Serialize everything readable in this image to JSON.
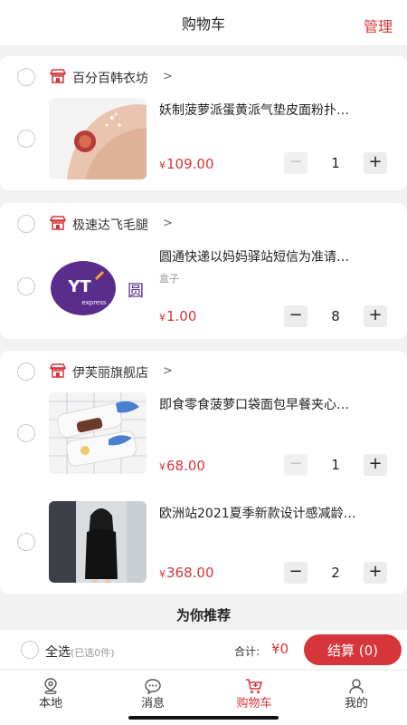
{
  "header": {
    "title": "购物车",
    "manage_label": "管理"
  },
  "shops": [
    {
      "name": "百分百韩衣坊",
      "items": [
        {
          "name": "妖制菠萝派蛋黄派气垫皮面粉扑…",
          "spec": "",
          "price_symbol": "¥",
          "price": "109.00",
          "qty": "1",
          "minus_disabled": true
        }
      ]
    },
    {
      "name": "极速达飞毛腿",
      "items": [
        {
          "name": "圆通快递以妈妈驿站短信为准请…",
          "spec": "盒子",
          "price_symbol": "¥",
          "price": "1.00",
          "qty": "8",
          "minus_disabled": false,
          "thumb_text": "YT",
          "thumb_sub": "express",
          "thumb_cn": "圆"
        }
      ]
    },
    {
      "name": "伊芙丽旗舰店",
      "items": [
        {
          "name": "即食零食菠萝口袋面包早餐夹心…",
          "spec": "",
          "price_symbol": "¥",
          "price": "68.00",
          "qty": "1",
          "minus_disabled": true
        },
        {
          "name": "欧洲站2021夏季新款设计感减龄…",
          "spec": "",
          "price_symbol": "¥",
          "price": "368.00",
          "qty": "2",
          "minus_disabled": false
        }
      ]
    }
  ],
  "stepper": {
    "minus": "−",
    "plus": "+"
  },
  "recommend_title": "为你推荐",
  "bottom": {
    "select_all": "全选",
    "selected_count": "(已选0件)",
    "total_label": "合计:",
    "total_value": "¥0",
    "checkout": "结算 (0)"
  },
  "tabs": [
    {
      "label": "本地",
      "icon": "location-pin-icon"
    },
    {
      "label": "消息",
      "icon": "chat-bubble-icon"
    },
    {
      "label": "购物车",
      "icon": "cart-icon",
      "active": true
    },
    {
      "label": "我的",
      "icon": "user-icon"
    }
  ],
  "colors": {
    "accent": "#d6353a",
    "background": "#f2f2f2"
  }
}
